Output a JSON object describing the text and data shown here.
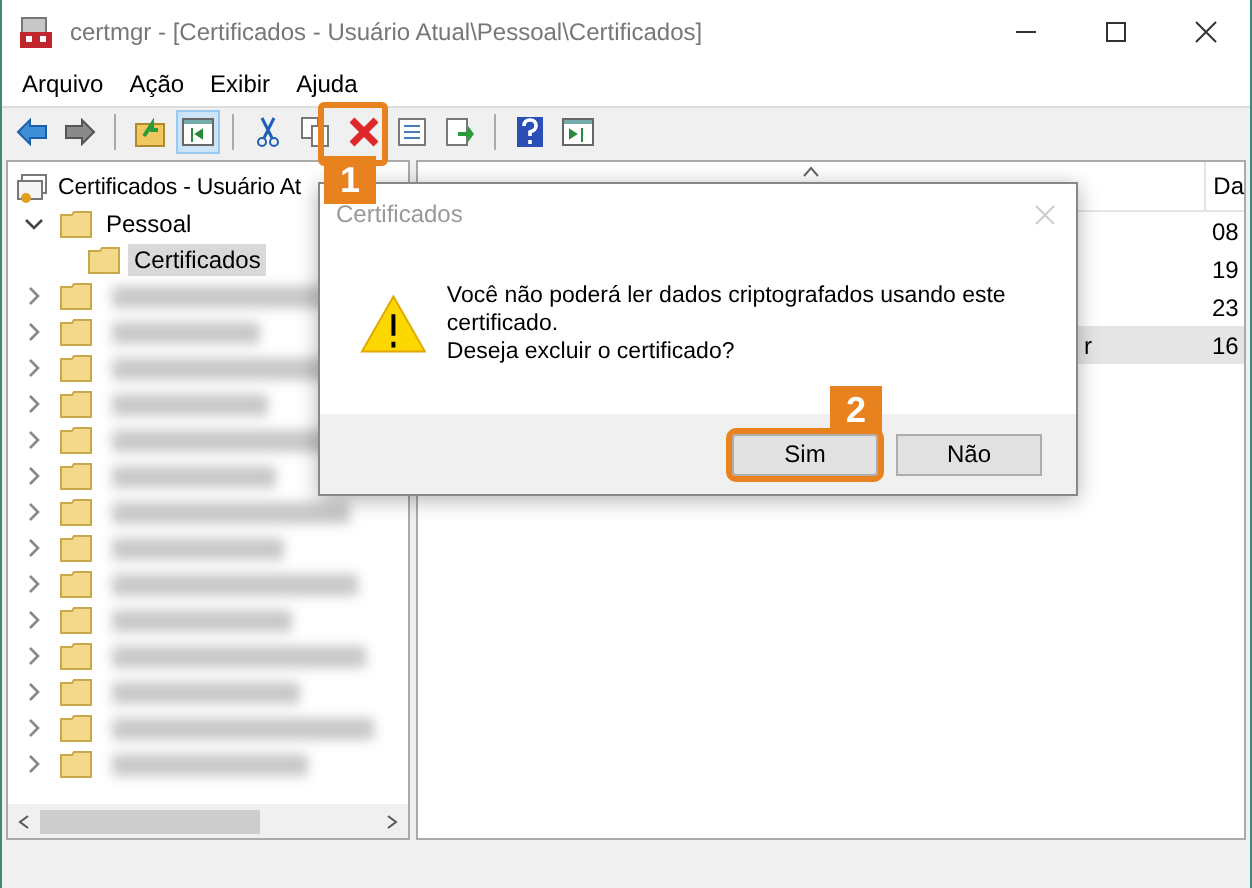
{
  "window": {
    "title": "certmgr - [Certificados - Usuário Atual\\Pessoal\\Certificados]"
  },
  "menu": [
    "Arquivo",
    "Ação",
    "Exibir",
    "Ajuda"
  ],
  "toolbar": [
    {
      "kind": "back",
      "selected": false
    },
    {
      "kind": "forward",
      "selected": false
    },
    {
      "kind": "up",
      "selected": false
    },
    {
      "kind": "tree",
      "selected": true
    },
    {
      "kind": "cut",
      "selected": false
    },
    {
      "kind": "copy",
      "selected": false
    },
    {
      "kind": "delete",
      "selected": false
    },
    {
      "kind": "properties",
      "selected": false
    },
    {
      "kind": "export",
      "selected": false
    },
    {
      "kind": "help",
      "selected": false
    },
    {
      "kind": "pane",
      "selected": false
    }
  ],
  "tree": {
    "label": "Certificados - Usuário At",
    "children": [
      {
        "label": "Pessoal",
        "kind": "folder",
        "expanded": true,
        "children": [
          {
            "label": "Certificados",
            "kind": "folder",
            "selected": true
          }
        ]
      },
      {
        "kind": "redacted"
      },
      {
        "kind": "redacted"
      },
      {
        "kind": "redacted"
      },
      {
        "kind": "redacted"
      },
      {
        "kind": "redacted"
      },
      {
        "kind": "redacted"
      },
      {
        "kind": "redacted"
      },
      {
        "kind": "redacted"
      },
      {
        "kind": "redacted"
      },
      {
        "kind": "redacted"
      },
      {
        "kind": "redacted"
      },
      {
        "kind": "redacted"
      },
      {
        "kind": "redacted"
      },
      {
        "kind": "redacted"
      }
    ]
  },
  "list": {
    "columns": [
      "Da"
    ],
    "rows": [
      {
        "column_1": "",
        "column_2": "08",
        "selected": false
      },
      {
        "column_1": "",
        "column_2": "19",
        "selected": false
      },
      {
        "column_1": "",
        "column_2": "23",
        "selected": false
      },
      {
        "column_1": "r",
        "column_2": "16",
        "selected": true
      }
    ]
  },
  "dialog": {
    "title": "Certificados",
    "message": [
      "Você não poderá ler dados criptografados usando este certificado.",
      "Deseja excluir o certificado?"
    ],
    "buttons": [
      {
        "label": "Sim",
        "highlighted": true
      },
      {
        "label": "Não",
        "highlighted": false
      }
    ]
  },
  "steps": [
    "1",
    "2"
  ]
}
